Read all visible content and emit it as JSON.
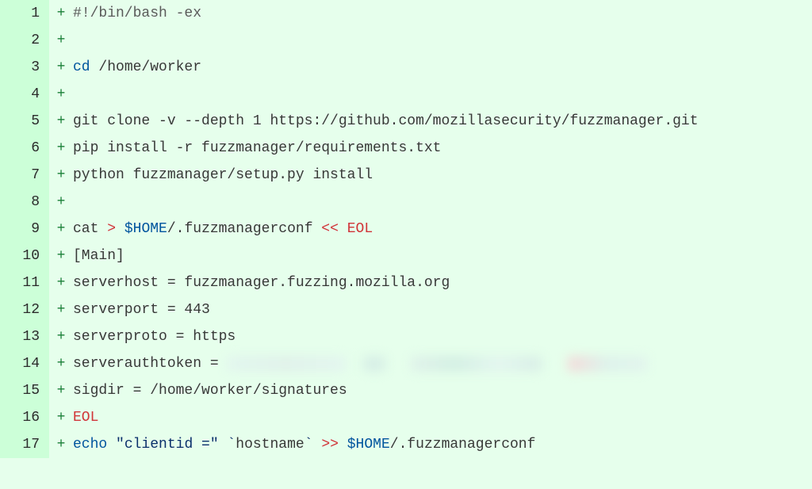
{
  "lines": [
    {
      "n": "1",
      "marker": "+",
      "segs": [
        {
          "t": "#!/bin/bash -ex",
          "cls": "c-gray"
        }
      ]
    },
    {
      "n": "2",
      "marker": "+",
      "segs": []
    },
    {
      "n": "3",
      "marker": "+",
      "segs": [
        {
          "t": "cd",
          "cls": "c-teal"
        },
        {
          "t": " /home/worker"
        }
      ]
    },
    {
      "n": "4",
      "marker": "+",
      "segs": []
    },
    {
      "n": "5",
      "marker": "+",
      "segs": [
        {
          "t": "git clone -v --depth 1 https://github.com/mozillasecurity/fuzzmanager.git"
        }
      ]
    },
    {
      "n": "6",
      "marker": "+",
      "segs": [
        {
          "t": "pip install -r fuzzmanager/requirements.txt"
        }
      ]
    },
    {
      "n": "7",
      "marker": "+",
      "segs": [
        {
          "t": "python fuzzmanager/setup.py install"
        }
      ]
    },
    {
      "n": "8",
      "marker": "+",
      "segs": []
    },
    {
      "n": "9",
      "marker": "+",
      "segs": [
        {
          "t": "cat "
        },
        {
          "t": ">",
          "cls": "c-red"
        },
        {
          "t": " "
        },
        {
          "t": "$HOME",
          "cls": "c-teal"
        },
        {
          "t": "/.fuzzmanagerconf "
        },
        {
          "t": "<<",
          "cls": "c-red"
        },
        {
          "t": " "
        },
        {
          "t": "EOL",
          "cls": "c-red"
        }
      ]
    },
    {
      "n": "10",
      "marker": "+",
      "segs": [
        {
          "t": "[Main]"
        }
      ]
    },
    {
      "n": "11",
      "marker": "+",
      "segs": [
        {
          "t": "serverhost = fuzzmanager.fuzzing.mozilla.org"
        }
      ]
    },
    {
      "n": "12",
      "marker": "+",
      "segs": [
        {
          "t": "serverport = 443"
        }
      ]
    },
    {
      "n": "13",
      "marker": "+",
      "segs": [
        {
          "t": "serverproto = https"
        }
      ]
    },
    {
      "n": "14",
      "marker": "+",
      "segs": [
        {
          "t": "serverauthtoken = "
        },
        {
          "redacted": "b1"
        },
        {
          "t": "  "
        },
        {
          "redacted": "b2"
        },
        {
          "t": "   "
        },
        {
          "redacted": "b3"
        },
        {
          "t": "   "
        },
        {
          "redacted": "b4"
        }
      ]
    },
    {
      "n": "15",
      "marker": "+",
      "segs": [
        {
          "t": "sigdir = /home/worker/signatures"
        }
      ]
    },
    {
      "n": "16",
      "marker": "+",
      "segs": [
        {
          "t": "EOL",
          "cls": "c-red"
        }
      ]
    },
    {
      "n": "17",
      "marker": "+",
      "segs": [
        {
          "t": "echo",
          "cls": "c-teal"
        },
        {
          "t": " "
        },
        {
          "t": "\"clientid =\"",
          "cls": "c-navy"
        },
        {
          "t": " "
        },
        {
          "t": "`",
          "cls": "c-navy"
        },
        {
          "t": "hostname"
        },
        {
          "t": "`",
          "cls": "c-navy"
        },
        {
          "t": " "
        },
        {
          "t": ">>",
          "cls": "c-red"
        },
        {
          "t": " "
        },
        {
          "t": "$HOME",
          "cls": "c-teal"
        },
        {
          "t": "/.fuzzmanagerconf"
        }
      ]
    }
  ]
}
